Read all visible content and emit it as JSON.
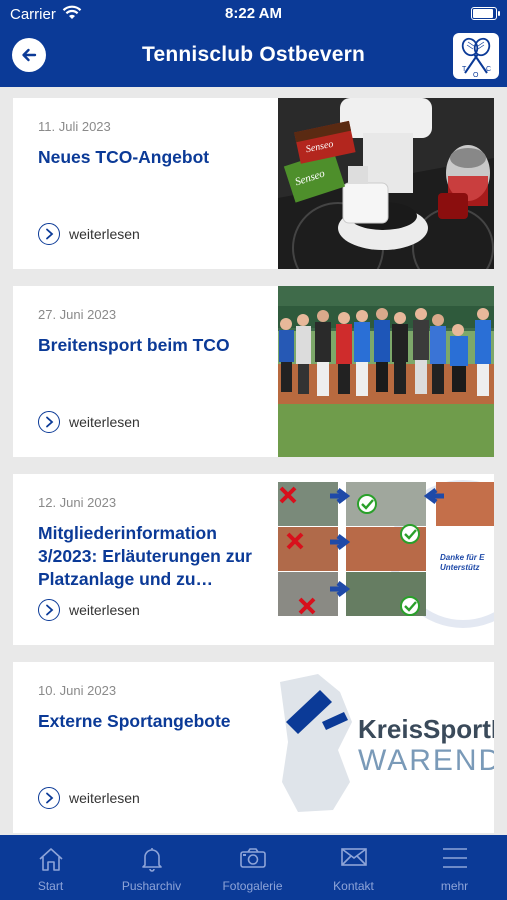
{
  "status": {
    "carrier": "Carrier",
    "time": "8:22 AM"
  },
  "header": {
    "title": "Tennisclub Ostbevern",
    "logo_text": "T O C",
    "accent": "#0b3a97"
  },
  "articles": [
    {
      "date": "11. Juli 2023",
      "title": "Neues TCO-Angebot",
      "link": "weiterlesen"
    },
    {
      "date": "27. Juni 2023",
      "title": "Breitensport beim TCO",
      "link": "weiterlesen"
    },
    {
      "date": "12. Juni 2023",
      "title": "Mitgliederinformation 3/2023: Erläuterungen zur Platzanlage und zu…",
      "link": "weiterlesen",
      "image_caption": "Danke für E Unterstütz"
    },
    {
      "date": "10. Juni 2023",
      "title": "Externe Sportangebote",
      "link": "weiterlesen",
      "image_caption_1": "KreisSportB",
      "image_caption_2": "WARENDO"
    }
  ],
  "tabs": [
    {
      "label": "Start",
      "icon": "home-icon"
    },
    {
      "label": "Pusharchiv",
      "icon": "bell-icon"
    },
    {
      "label": "Fotogalerie",
      "icon": "camera-icon"
    },
    {
      "label": "Kontakt",
      "icon": "envelope-icon"
    },
    {
      "label": "mehr",
      "icon": "menu-icon"
    }
  ]
}
